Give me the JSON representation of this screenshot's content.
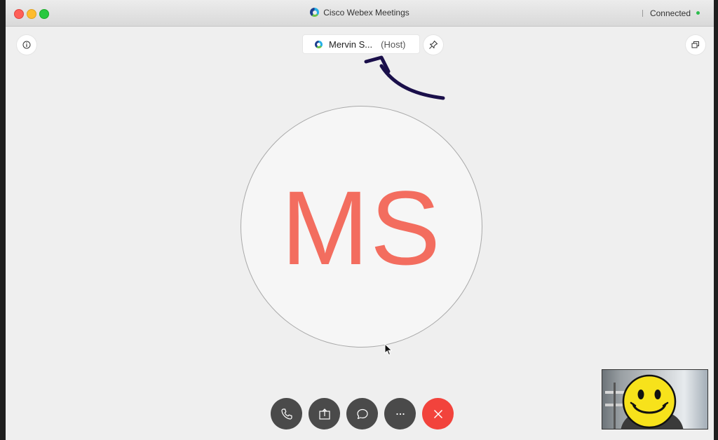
{
  "window": {
    "title": "Cisco Webex Meetings",
    "status": "Connected"
  },
  "host": {
    "name": "Mervin S...",
    "role": "(Host)"
  },
  "avatar": {
    "initials": "MS"
  },
  "icons": {
    "info": "info-icon",
    "pin": "pin-icon",
    "popout": "popout-icon",
    "phone": "phone-icon",
    "share": "share-icon",
    "chat": "chat-icon",
    "more": "more-icon",
    "end": "close-icon"
  },
  "colors": {
    "avatar_text": "#f36d5f",
    "end_call": "#f2433c",
    "control_bg": "#4a4a4a",
    "connected_dot": "#2dbd4e",
    "annotation": "#1a0f4a"
  }
}
